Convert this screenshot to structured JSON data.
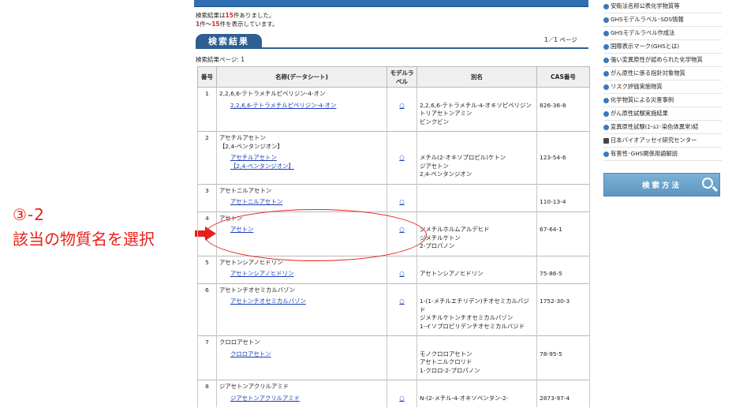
{
  "annotation": {
    "step": "③-2",
    "text": "該当の物質名を選択"
  },
  "summary": {
    "line1_prefix": "検索結果は",
    "line1_count": "15",
    "line1_suffix": "件ありました。",
    "line2_start": "1",
    "line2_mid": "件～",
    "line2_end": "15",
    "line2_suffix": "件を表示しています。"
  },
  "results_tab": "検索結果",
  "page_count": "1／1 ページ",
  "pages_line": "検索結果ページ: 1",
  "table": {
    "headers": [
      "番号",
      "名称(データシート)",
      "モデルラベル",
      "別名",
      "CAS番号"
    ],
    "rows": [
      {
        "no": "1",
        "group": "2,2,6,6-テトラメチルピペリジン-4-オン",
        "link": "2,2,6,6-テトラメチルピペリジン-4-オン",
        "model": "○",
        "alias": "2,2,6,6-テトラメチル-4-オキソピペリジン\nトリアセトンアミン\nビンクビン",
        "cas": "826-36-8"
      },
      {
        "no": "2",
        "group": "アセチルアセトン\n【2,4-ペンタンジオン】",
        "link": "アセチルアセトン\n【2,4-ペンタンジオン】",
        "model": "○",
        "alias": "メチル(2-オキソプロピル)ケトン\nジアセトン\n2,4-ペンタンジオン",
        "cas": "123-54-6"
      },
      {
        "no": "3",
        "group": "アセトニルアセトン",
        "link": "アセトニルアセトン",
        "model": "○",
        "alias": "",
        "cas": "110-13-4"
      },
      {
        "no": "4",
        "group": "アセトン",
        "link": "アセトン",
        "model": "○",
        "alias": "ジメチルホルムアルデヒド\nジメチルケトン\n2-プロパノン",
        "cas": "67-64-1"
      },
      {
        "no": "5",
        "group": "アセトンシアノヒドリン",
        "link": "アセトンシアノヒドリン",
        "model": "○",
        "alias": "アセトンシアノヒドリン",
        "cas": "75-86-5"
      },
      {
        "no": "6",
        "group": "アセトンチオセミカルバゾン",
        "link": "アセトンチオセミカルバゾン",
        "model": "○",
        "alias": "1-(1-メチルエチリデン)チオセミカルバジド\nジメチルケトンチオセミカルバゾン\n1-イソプロピリデンチオセミカルバジド",
        "cas": "1752-30-3"
      },
      {
        "no": "7",
        "group": "クロロアセトン",
        "link": "クロロアセトン",
        "model": "",
        "alias": "モノクロロアセトン\nアセトニルクロリド\n1-クロロ-2-プロパノン",
        "cas": "78-95-5"
      },
      {
        "no": "8",
        "group": "ジアセトンアクリルアミド",
        "link": "ジアセトンアクリルアミド",
        "model": "○",
        "alias": "N-(2-メチル-4-オキソペンタン-2-",
        "cas": "2873-97-4"
      }
    ]
  },
  "sidebar": {
    "items": [
      {
        "label": "安衛法名称公表化学物質等",
        "icon": "blue-dot"
      },
      {
        "label": "GHSモデルラベル･SDS情報",
        "icon": "blue-dot"
      },
      {
        "label": "GHSモデルラベル作成法",
        "icon": "blue-dot"
      },
      {
        "label": "国際表示マーク(GHSとは)",
        "icon": "blue-dot"
      },
      {
        "label": "強い変異原性が認められた化学物質",
        "icon": "blue-dot"
      },
      {
        "label": "がん原性に係る指針対象物質",
        "icon": "blue-dot"
      },
      {
        "label": "リスク評価実施物質",
        "icon": "blue-dot"
      },
      {
        "label": "化学物質による災害事例",
        "icon": "blue-dot"
      },
      {
        "label": "がん原性試験実施結果",
        "icon": "blue-dot"
      },
      {
        "label": "変異原性試験(ｴｰﾑｽ･染色体異常)結",
        "icon": "blue-dot"
      },
      {
        "label": "日本バイオアッセイ研究センター",
        "icon": "building"
      },
      {
        "label": "有害性･GHS関係用語解説",
        "icon": "blue-dot"
      }
    ],
    "howto_button": "検索方法"
  },
  "colors": {
    "accent": "#2d5f93",
    "annotation": "#e8201a",
    "link": "#1a3db8"
  }
}
